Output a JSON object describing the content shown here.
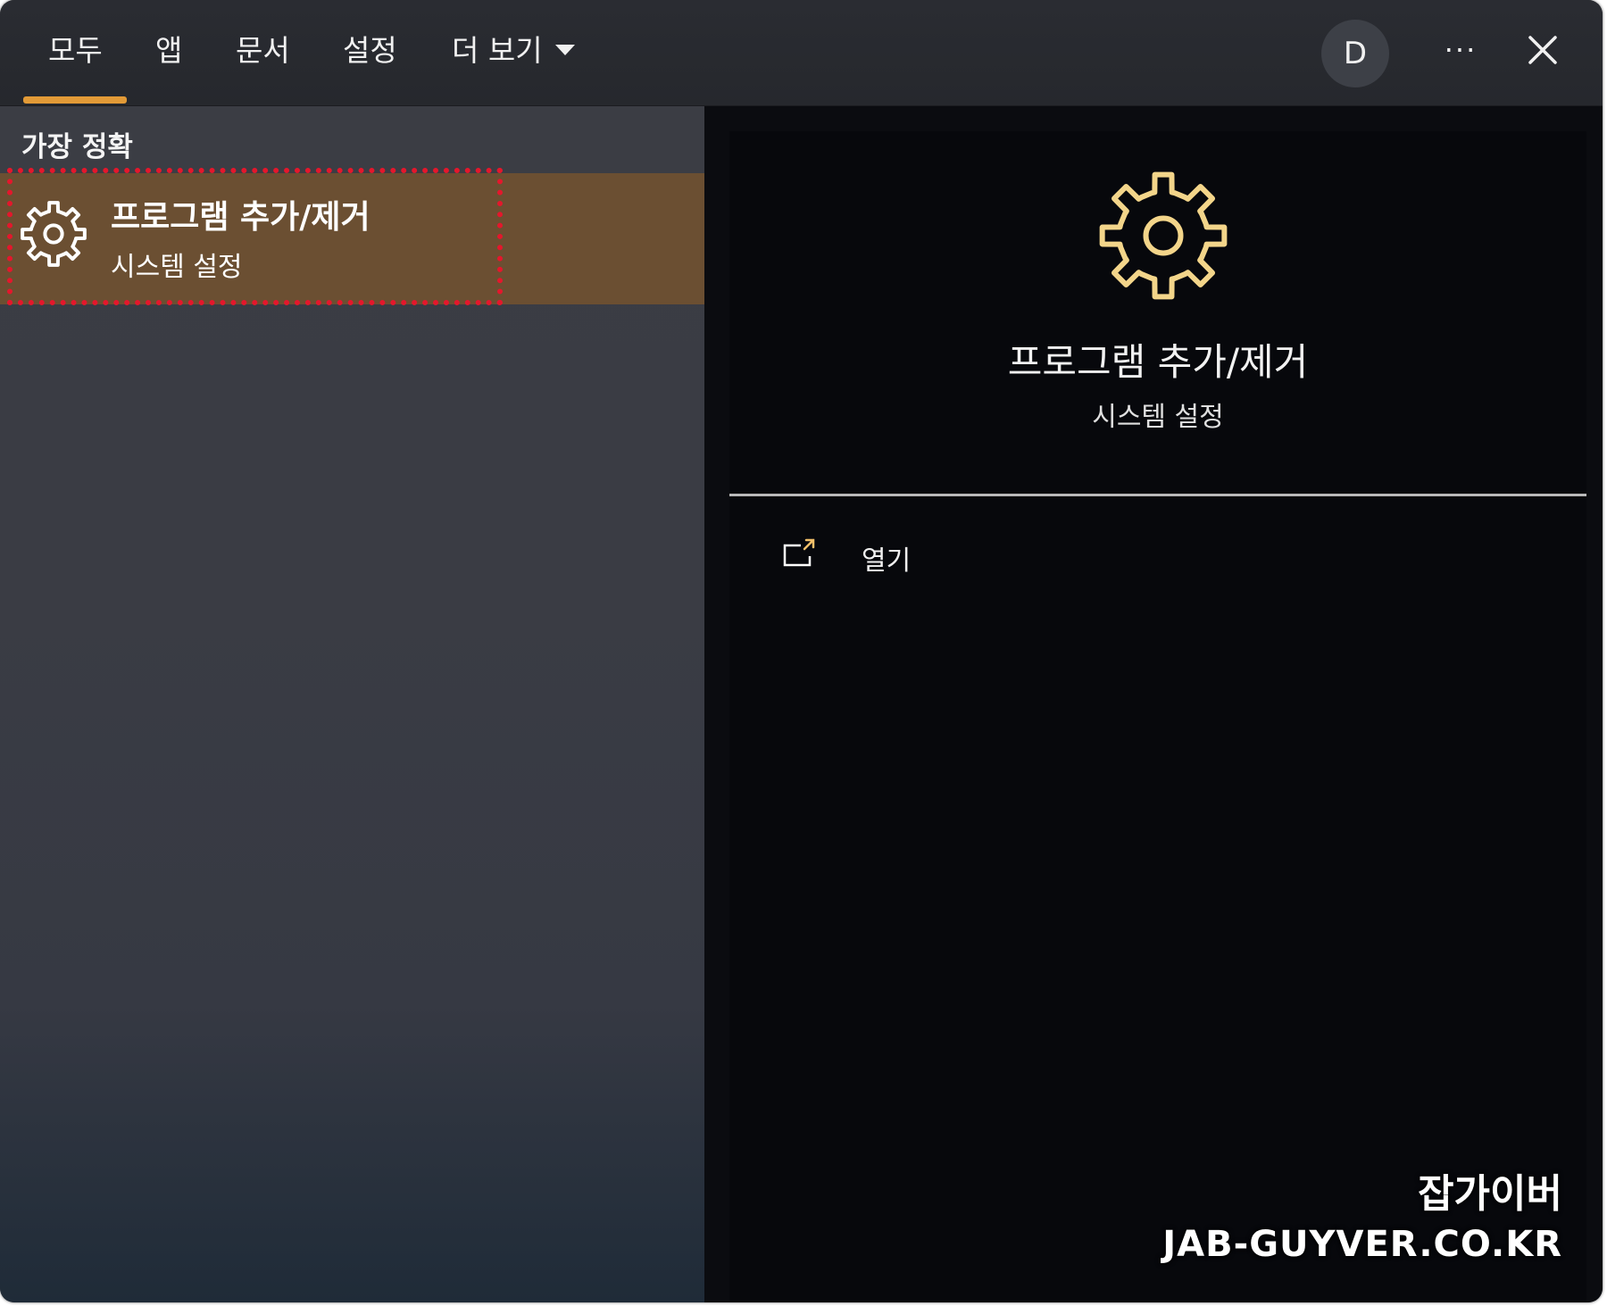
{
  "tabs": [
    {
      "label": "모두",
      "active": true
    },
    {
      "label": "앱",
      "active": false
    },
    {
      "label": "문서",
      "active": false
    },
    {
      "label": "설정",
      "active": false
    },
    {
      "label": "더 보기",
      "active": false
    }
  ],
  "header": {
    "avatar_initial": "D",
    "more_label": "···",
    "accent_color": "#e29a37"
  },
  "results": {
    "section_label": "가장 정확",
    "best_match": {
      "title": "프로그램 추가/제거",
      "subtitle": "시스템 설정",
      "icon": "gear-icon",
      "highlight_color": "#e4172c",
      "background_color": "#6b4f32"
    }
  },
  "detail": {
    "icon": "gear-icon",
    "icon_color": "#f3d58a",
    "title": "프로그램 추가/제거",
    "subtitle": "시스템 설정",
    "actions": [
      {
        "label": "열기",
        "icon": "open-external-icon"
      }
    ]
  },
  "watermark": {
    "line1": "잡가이버",
    "line2": "JAB-GUYVER.CO.KR"
  }
}
